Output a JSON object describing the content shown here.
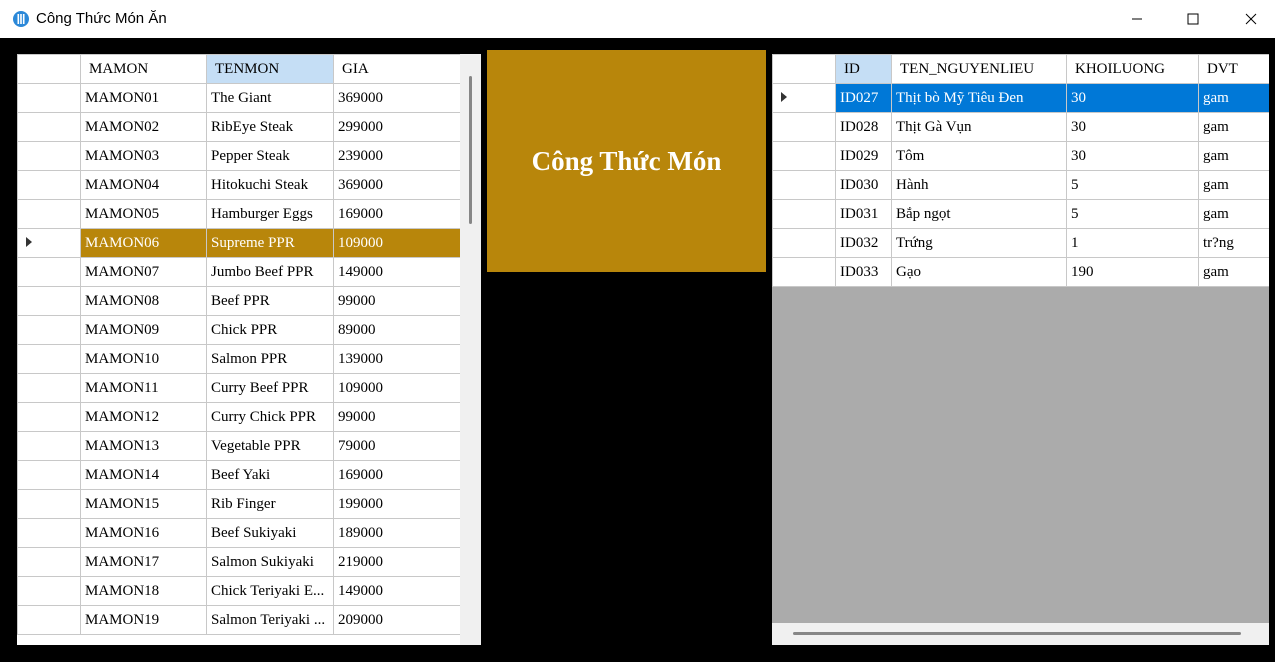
{
  "window": {
    "title": "Công Thức Món Ăn"
  },
  "banner": {
    "title": "Công Thức Món"
  },
  "dishes": {
    "columns": [
      "MAMON",
      "TENMON",
      "GIA"
    ],
    "selected_index": 5,
    "rows": [
      [
        "MAMON01",
        "The Giant",
        "369000"
      ],
      [
        "MAMON02",
        "RibEye Steak",
        "299000"
      ],
      [
        "MAMON03",
        "Pepper Steak",
        "239000"
      ],
      [
        "MAMON04",
        "Hitokuchi Steak",
        "369000"
      ],
      [
        "MAMON05",
        "Hamburger Eggs",
        "169000"
      ],
      [
        "MAMON06",
        "Supreme PPR",
        "109000"
      ],
      [
        "MAMON07",
        "Jumbo Beef PPR",
        "149000"
      ],
      [
        "MAMON08",
        "Beef PPR",
        "99000"
      ],
      [
        "MAMON09",
        "Chick PPR",
        "89000"
      ],
      [
        "MAMON10",
        "Salmon PPR",
        "139000"
      ],
      [
        "MAMON11",
        "Curry Beef PPR",
        "109000"
      ],
      [
        "MAMON12",
        "Curry Chick PPR",
        "99000"
      ],
      [
        "MAMON13",
        "Vegetable PPR",
        "79000"
      ],
      [
        "MAMON14",
        "Beef Yaki",
        "169000"
      ],
      [
        "MAMON15",
        "Rib Finger",
        "199000"
      ],
      [
        "MAMON16",
        "Beef Sukiyaki",
        "189000"
      ],
      [
        "MAMON17",
        "Salmon Sukiyaki",
        "219000"
      ],
      [
        "MAMON18",
        "Chick Teriyaki E...",
        "149000"
      ],
      [
        "MAMON19",
        "Salmon Teriyaki ...",
        "209000"
      ]
    ]
  },
  "ingredients": {
    "columns": [
      "ID",
      "TEN_NGUYENLIEU",
      "KHOILUONG",
      "DVT"
    ],
    "selected_index": 0,
    "rows": [
      [
        "ID027",
        "Thịt bò Mỹ Tiêu Đen",
        "30",
        "gam"
      ],
      [
        "ID028",
        "Thịt Gà Vụn",
        "30",
        "gam"
      ],
      [
        "ID029",
        "Tôm",
        "30",
        "gam"
      ],
      [
        "ID030",
        "Hành",
        "5",
        "gam"
      ],
      [
        "ID031",
        "Bắp ngọt",
        "5",
        "gam"
      ],
      [
        "ID032",
        "Trứng",
        "1",
        "tr?ng"
      ],
      [
        "ID033",
        "Gạo",
        "190",
        "gam"
      ]
    ]
  },
  "colors": {
    "accent_gold": "#b8860b",
    "selection_blue": "#0078d7",
    "header_selected": "#c5def5"
  }
}
